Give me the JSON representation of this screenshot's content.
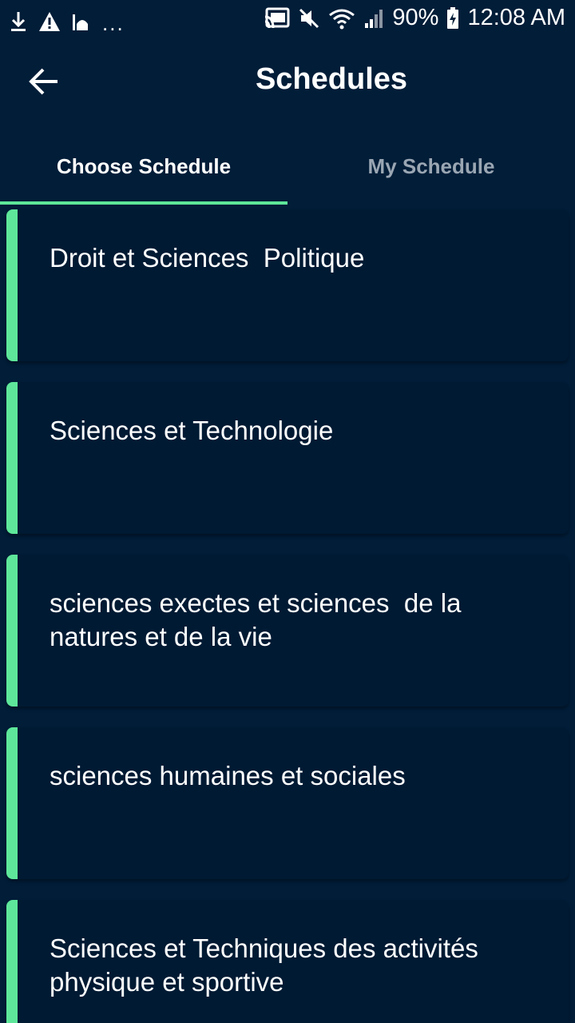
{
  "status_bar": {
    "left_icons": [
      "download-icon",
      "warning-icon",
      "mosque-icon"
    ],
    "overflow": "...",
    "battery": "90%",
    "time": "12:08 AM"
  },
  "app_bar": {
    "title": "Schedules"
  },
  "tabs": [
    {
      "label": "Choose Schedule",
      "active": true
    },
    {
      "label": "My Schedule",
      "active": false
    }
  ],
  "schedules": [
    {
      "label": "Droit et Sciences  Politique"
    },
    {
      "label": "Sciences et Technologie"
    },
    {
      "label": "sciences exectes et sciences  de la natures et de la vie"
    },
    {
      "label": "sciences humaines et sociales"
    },
    {
      "label": "Sciences et Techniques des activités physique et sportive"
    }
  ],
  "colors": {
    "background": "#011d38",
    "accent": "#5ee79a",
    "inactive_tab": "#9aa6b3"
  }
}
